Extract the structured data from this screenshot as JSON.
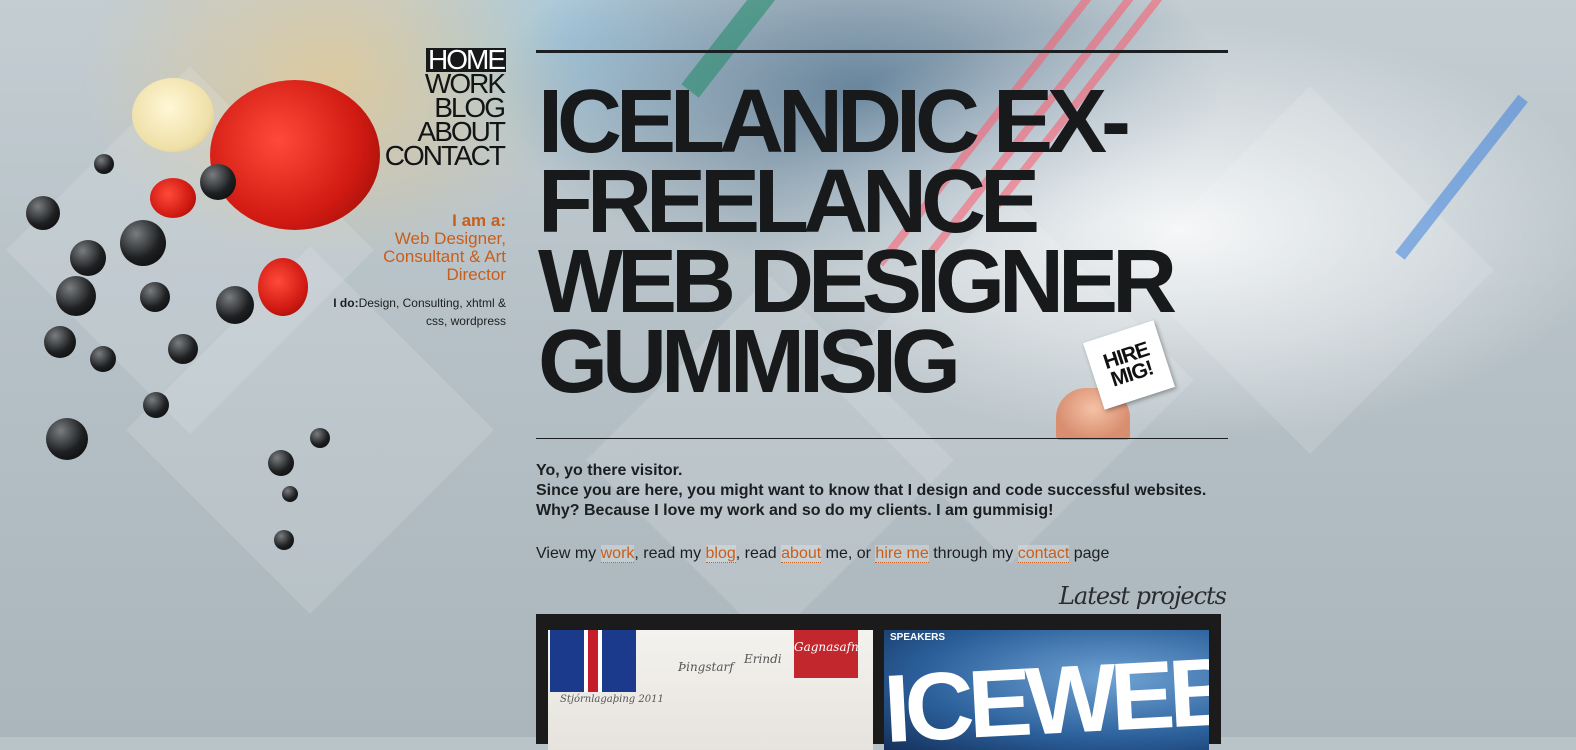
{
  "nav": [
    {
      "label": "HOME",
      "active": true
    },
    {
      "label": "WORK",
      "active": false
    },
    {
      "label": "BLOG",
      "active": false
    },
    {
      "label": "ABOUT",
      "active": false
    },
    {
      "label": "CONTACT",
      "active": false
    }
  ],
  "iama": {
    "label": "I am a:",
    "roles": "Web Designer, Consultant & Art Director"
  },
  "ido": {
    "label": "I do:",
    "items": "Design, Consulting, xhtml & css, wordpress"
  },
  "headline": {
    "line1": "ICELANDIC EX-",
    "line2": "FREELANCE",
    "line3": "WEB DESIGNER",
    "line4": "GUMMISIG"
  },
  "hire_card": "HIRE MIG!",
  "intro": {
    "line1": "Yo, yo there visitor.",
    "line2": "Since you are here, you might want to know that I design and code successful websites.",
    "line3": "Why? Because I love my work and so do my clients. I am gummisig!"
  },
  "links_sentence": {
    "t1": "View my ",
    "work": "work",
    "t2": ", read my ",
    "blog": "blog",
    "t3": ", read ",
    "about": "about",
    "t4": " me, or ",
    "hire": "hire me",
    "t5": " through my ",
    "contact": "contact",
    "t6": " page"
  },
  "latest_projects": "Latest projects",
  "projects": [
    {
      "flag_caption": "Stjórnlagaþing 2011",
      "tab1": "Þingstarf",
      "tab2": "Erindi",
      "ribbon": "Gagnasafn"
    },
    {
      "label": "SPEAKERS",
      "title": "ICEWEB"
    }
  ],
  "colors": {
    "accent": "#c85e1c",
    "text": "#1c1f21",
    "nav_active_bg": "#161819"
  }
}
